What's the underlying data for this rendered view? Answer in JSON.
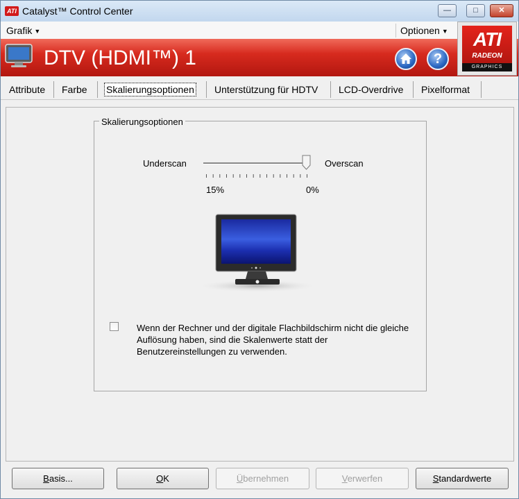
{
  "window": {
    "title": "Catalyst™ Control Center",
    "logo_text": "ATI",
    "controls": [
      "minimize",
      "maximize",
      "close"
    ]
  },
  "menubar": {
    "left": {
      "label": "Grafik"
    },
    "right": {
      "label": "Optionen"
    }
  },
  "header": {
    "title": "DTV (HDMI™) 1",
    "home_icon": "home-icon",
    "help_icon": "help-icon",
    "accent": "#d72a1e"
  },
  "brand": {
    "word": "ATI",
    "sub": "RADEON",
    "line": "GRAPHICS"
  },
  "tabs": [
    {
      "label": "Attribute",
      "active": false
    },
    {
      "label": "Farbe",
      "active": false
    },
    {
      "label": "Skalierungsoptionen",
      "active": true
    },
    {
      "label": "Unterstützung für HDTV",
      "active": false
    },
    {
      "label": "LCD-Overdrive",
      "active": false
    },
    {
      "label": "Pixelformat",
      "active": false
    }
  ],
  "scaling": {
    "group_title": "Skalierungsoptionen",
    "left_label": "Underscan",
    "right_label": "Overscan",
    "min_value_label": "15%",
    "max_value_label": "0%",
    "slider_value_percent": 0,
    "checkbox_checked": false,
    "checkbox_text": "Wenn der Rechner und der digitale Flachbildschirm nicht die gleiche Auflösung haben, sind die Skalenwerte statt der Benutzereinstellungen zu verwenden."
  },
  "buttons": {
    "basis": {
      "prefix": "",
      "accel": "B",
      "rest": "asis...",
      "enabled": true
    },
    "ok": {
      "prefix": "",
      "accel": "O",
      "rest": "K",
      "enabled": true
    },
    "apply": {
      "prefix": "",
      "accel": "Ü",
      "rest": "bernehmen",
      "enabled": false
    },
    "discard": {
      "prefix": "",
      "accel": "V",
      "rest": "erwerfen",
      "enabled": false
    },
    "defaults": {
      "prefix": "",
      "accel": "S",
      "rest": "tandardwerte",
      "enabled": true
    }
  }
}
